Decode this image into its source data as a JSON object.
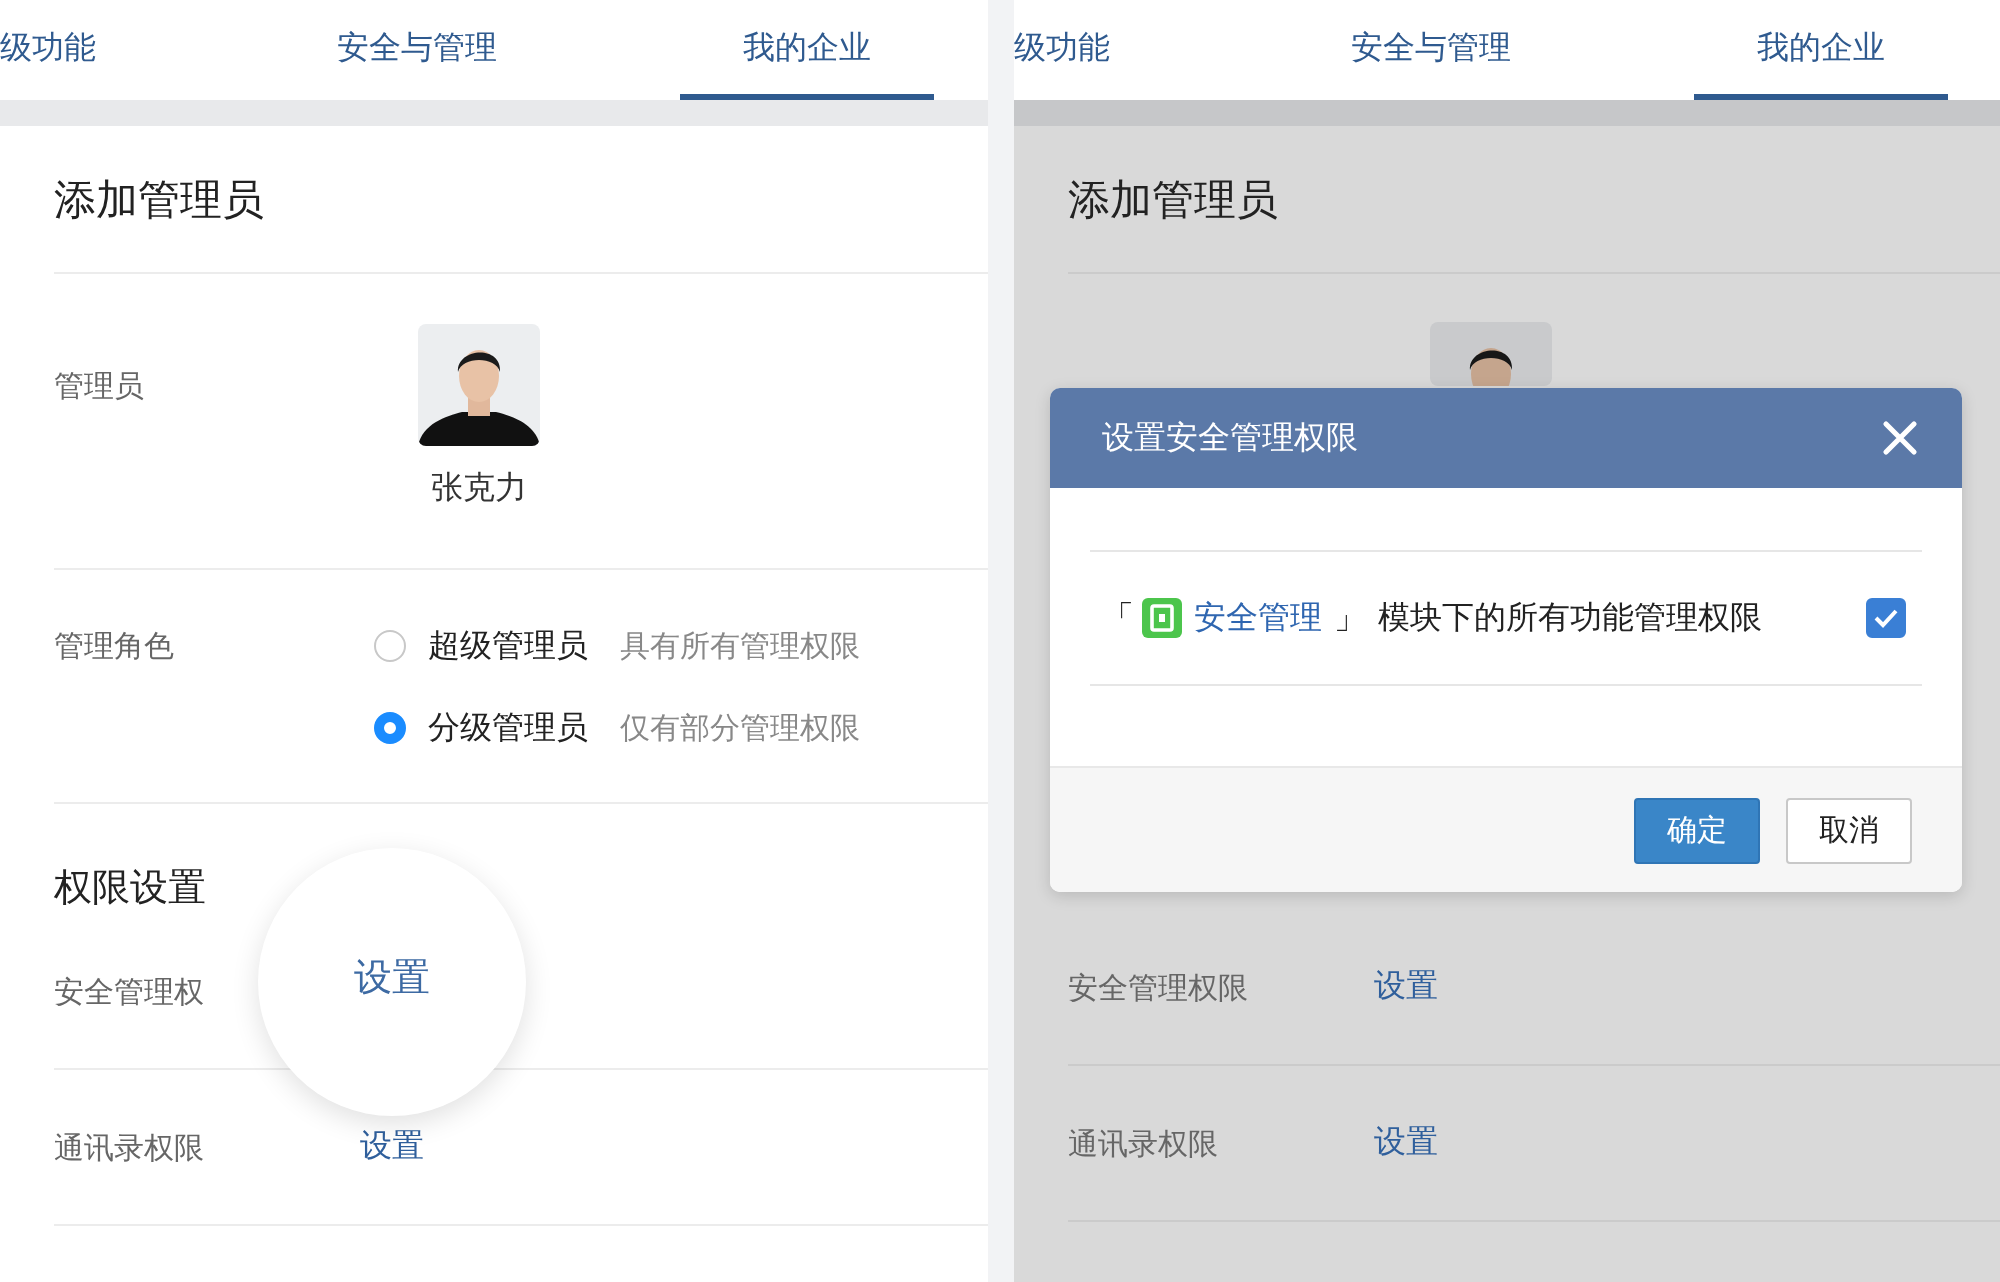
{
  "screens": [
    {
      "dimmed": false,
      "tabs": [
        {
          "label": "级功能",
          "selected": false
        },
        {
          "label": "安全与管理",
          "selected": false
        },
        {
          "label": "我的企业",
          "selected": true
        }
      ],
      "title": "添加管理员",
      "admin": {
        "label": "管理员",
        "name": "张克力"
      },
      "role": {
        "label": "管理角色",
        "options": [
          {
            "label": "超级管理员",
            "hint": "具有所有管理权限",
            "selected": false
          },
          {
            "label": "分级管理员",
            "hint": "仅有部分管理权限",
            "selected": true
          }
        ]
      },
      "permissions": {
        "title": "权限设置",
        "rows": [
          {
            "label": "安全管理权",
            "link": "设置",
            "magnified": true
          },
          {
            "label": "通讯录权限",
            "link": "设置",
            "magnified": false
          }
        ]
      }
    },
    {
      "dimmed": true,
      "tabs": [
        {
          "label": "级功能",
          "selected": false
        },
        {
          "label": "安全与管理",
          "selected": false
        },
        {
          "label": "我的企业",
          "selected": true
        }
      ],
      "title": "添加管理员",
      "permissions": {
        "rows": [
          {
            "label": "安全管理权限",
            "link": "设置",
            "magnified": false
          },
          {
            "label": "通讯录权限",
            "link": "设置",
            "magnified": false
          }
        ]
      },
      "dialog": {
        "title": "设置安全管理权限",
        "permission": {
          "open_bracket": "「",
          "module": "安全管理",
          "close_bracket": "」",
          "text": "模块下的所有功能管理权限",
          "checked": true
        },
        "buttons": [
          {
            "label": "确定",
            "kind": "primary"
          },
          {
            "label": "取消",
            "kind": "secondary"
          }
        ]
      }
    }
  ]
}
